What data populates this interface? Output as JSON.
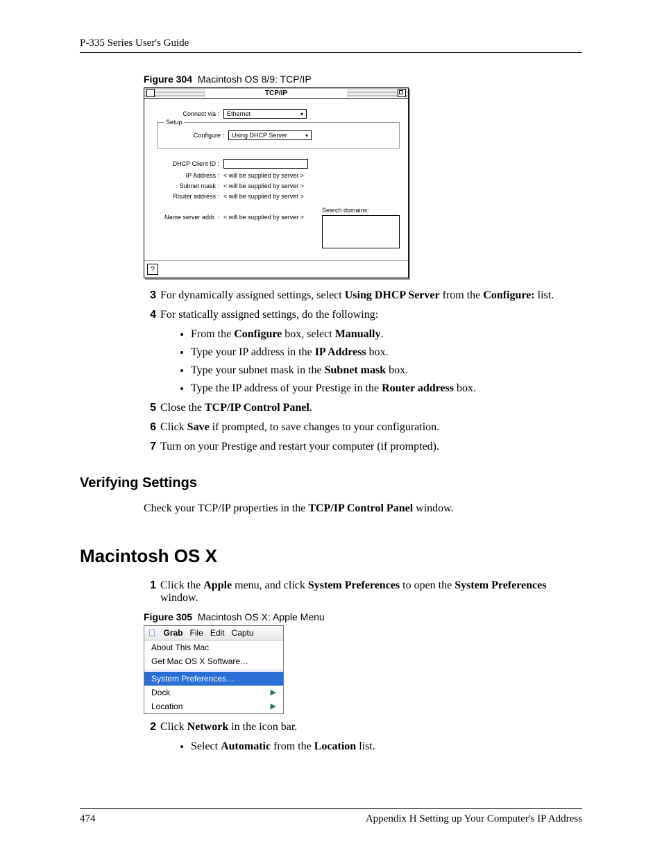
{
  "header": {
    "title": "P-335 Series User's Guide"
  },
  "figure304": {
    "label": "Figure 304",
    "caption": "Macintosh OS 8/9: TCP/IP",
    "window_title": "TCP/IP",
    "connect_via_label": "Connect via :",
    "connect_via_value": "Ethernet",
    "setup_label": "Setup",
    "configure_label": "Configure :",
    "configure_value": "Using DHCP Server",
    "dhcp_client_id_label": "DHCP Client ID :",
    "ip_address_label": "IP Address :",
    "ip_address_value": "< will be supplied by server >",
    "subnet_mask_label": "Subnet mask :",
    "subnet_mask_value": "< will be supplied by server >",
    "router_address_label": "Router address :",
    "router_address_value": "< will be supplied by server >",
    "name_server_label": "Name server addr. :",
    "name_server_value": "< will be supplied by server >",
    "search_domains_label": "Search domains:"
  },
  "steps": {
    "s3_num": "3",
    "s3_a": "For dynamically assigned settings, select ",
    "s3_b": "Using DHCP Server",
    "s3_c": " from the ",
    "s3_d": "Configure:",
    "s3_e": " list.",
    "s4_num": "4",
    "s4_a": "For statically assigned settings, do the following:",
    "bullet1_a": "From the ",
    "bullet1_b": "Configure",
    "bullet1_c": " box, select ",
    "bullet1_d": "Manually",
    "bullet1_e": ".",
    "bullet2_a": "Type your IP address in the ",
    "bullet2_b": "IP Address",
    "bullet2_c": " box.",
    "bullet3_a": "Type your subnet mask in the ",
    "bullet3_b": "Subnet mask",
    "bullet3_c": " box.",
    "bullet4_a": "Type the IP address of your Prestige in the ",
    "bullet4_b": "Router address",
    "bullet4_c": " box.",
    "s5_num": "5",
    "s5_a": "Close the ",
    "s5_b": "TCP/IP Control Panel",
    "s5_c": ".",
    "s6_num": "6",
    "s6_a": "Click ",
    "s6_b": "Save",
    "s6_c": " if prompted, to save changes to your configuration.",
    "s7_num": "7",
    "s7_a": "Turn on your Prestige and restart your computer (if prompted)."
  },
  "verifying": {
    "heading": "Verifying Settings",
    "text_a": "Check your TCP/IP properties in the ",
    "text_b": "TCP/IP Control Panel",
    "text_c": " window."
  },
  "osx": {
    "heading": "Macintosh OS X",
    "s1_num": "1",
    "s1_a": "Click the ",
    "s1_b": "Apple",
    "s1_c": " menu, and click ",
    "s1_d": "System Preferences",
    "s1_e": " to open the ",
    "s1_f": "System Preferences",
    "s1_g": " window."
  },
  "figure305": {
    "label": "Figure 305",
    "caption": "Macintosh OS X: Apple Menu",
    "menubar": {
      "grab": "Grab",
      "file": "File",
      "edit": "Edit",
      "captu": "Captu"
    },
    "menu": {
      "about": "About This Mac",
      "getsw": "Get Mac OS X Software…",
      "sysprefs": "System Preferences…",
      "dock": "Dock",
      "location": "Location"
    }
  },
  "osx_steps": {
    "s2_num": "2",
    "s2_a": "Click ",
    "s2_b": "Network",
    "s2_c": " in the icon bar.",
    "bullet1_a": "Select ",
    "bullet1_b": "Automatic",
    "bullet1_c": " from the ",
    "bullet1_d": "Location",
    "bullet1_e": " list."
  },
  "footer": {
    "page": "474",
    "section": "Appendix H Setting up Your Computer's IP Address"
  }
}
